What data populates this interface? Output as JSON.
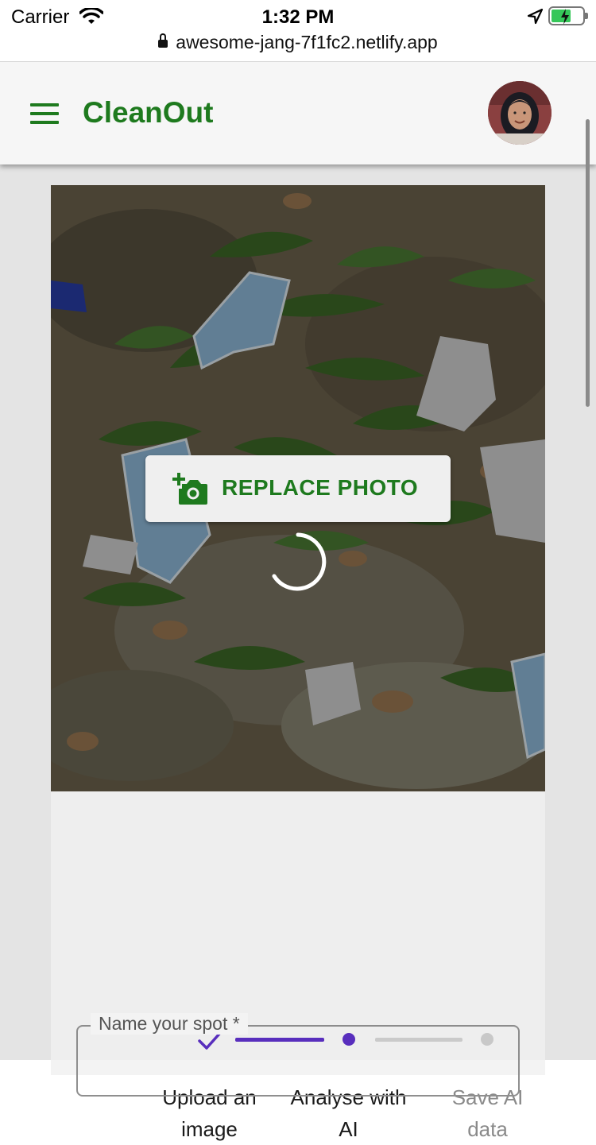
{
  "status_bar": {
    "carrier": "Carrier",
    "time": "1:32 PM",
    "url": "awesome-jang-7f1fc2.netlify.app",
    "icons": [
      "wifi-icon",
      "location-arrow-icon",
      "battery-charging-icon",
      "lock-icon"
    ]
  },
  "app_bar": {
    "title": "CleanOut",
    "menu_icon": "hamburger-menu-icon",
    "avatar": "user-avatar"
  },
  "photo_card": {
    "replace_button_label": "REPLACE PHOTO",
    "replace_button_icon": "add-a-photo-icon",
    "loading": true
  },
  "stepper": {
    "steps": [
      {
        "label": "Upload an image",
        "state": "completed"
      },
      {
        "label": "Analyse with AI",
        "state": "active"
      },
      {
        "label": "Save AI data",
        "state": "inactive"
      }
    ]
  },
  "form": {
    "spot_name_label": "Name your spot *"
  },
  "colors": {
    "brand_green": "#1e7a1e",
    "stepper_active": "#5a2fc1",
    "stepper_inactive": "#cdcdcd"
  }
}
